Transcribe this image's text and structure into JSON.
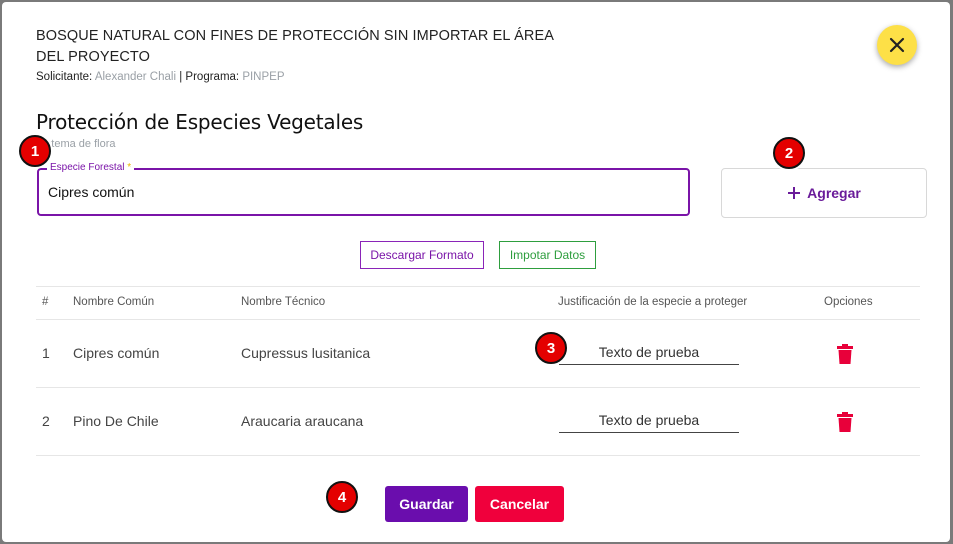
{
  "dialog": {
    "title": "BOSQUE NATURAL CON FINES DE PROTECCIÓN SIN IMPORTAR EL ÁREA DEL PROYECTO",
    "solicitante_label": "Solicitante:",
    "solicitante_value": "Alexander Chali",
    "separator": "|",
    "programa_label": "Programa:",
    "programa_value": "PINPEP",
    "close_icon": "close-icon",
    "close_color": "#fde047"
  },
  "section": {
    "title": "Protección de Especies Vegetales",
    "subtitle": "Sistema de flora"
  },
  "form": {
    "field_label": "Especie Forestal",
    "required_mark": "*",
    "field_value": "Cipres común",
    "add_label": "Agregar",
    "download_label": "Descargar Formato",
    "import_label": "Impotar Datos"
  },
  "table": {
    "headers": [
      "#",
      "Nombre Común",
      "Nombre Técnico",
      "Justificación de la especie a proteger",
      "Opciones"
    ],
    "rows": [
      {
        "num": "1",
        "comun": "Cipres común",
        "tecnico": "Cupressus lusitanica",
        "justificacion": "Texto de prueba"
      },
      {
        "num": "2",
        "comun": "Pino De Chile",
        "tecnico": "Araucaria araucana",
        "justificacion": "Texto de prueba"
      }
    ]
  },
  "actions": {
    "save_label": "Guardar",
    "cancel_label": "Cancelar"
  },
  "badges": [
    "1",
    "2",
    "3",
    "4"
  ],
  "colors": {
    "accent": "#7a14a8",
    "save": "#6a0dad",
    "cancel": "#f0003c",
    "import": "#2e9e3e",
    "delete": "#e8003a",
    "badge": "#e40000"
  }
}
